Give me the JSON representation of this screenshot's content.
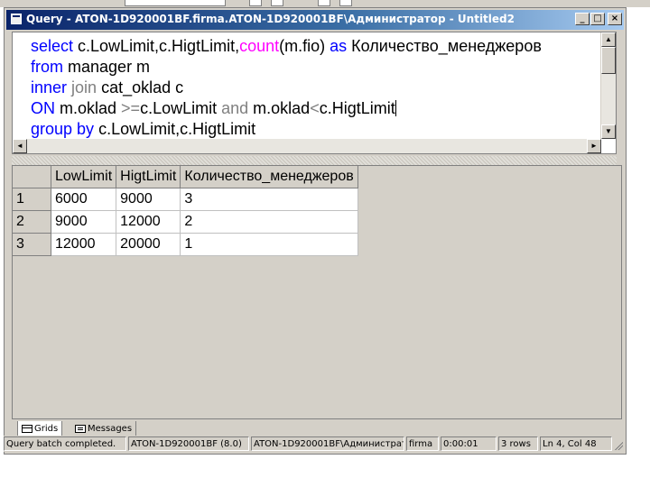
{
  "window": {
    "title": "Query - ATON-1D920001BF.firma.ATON-1D920001BF\\Администратор - Untitled2*"
  },
  "title_buttons": {
    "minimize": "_",
    "maximize": "□",
    "close": "×"
  },
  "editor": {
    "lines": [
      [
        {
          "t": "select ",
          "c": "kw"
        },
        {
          "t": "c.LowLimit,c.HigtLimit,",
          "c": "tx"
        },
        {
          "t": "count",
          "c": "fn"
        },
        {
          "t": "(m.fio) ",
          "c": "tx"
        },
        {
          "t": "as ",
          "c": "kw"
        },
        {
          "t": "Количество_менеджеров",
          "c": "tx"
        }
      ],
      [
        {
          "t": "from ",
          "c": "kw"
        },
        {
          "t": "manager m",
          "c": "tx"
        }
      ],
      [
        {
          "t": "inner ",
          "c": "kw"
        },
        {
          "t": "join ",
          "c": "op"
        },
        {
          "t": "cat_oklad c",
          "c": "tx"
        }
      ],
      [
        {
          "t": "ON ",
          "c": "kw"
        },
        {
          "t": "m.oklad ",
          "c": "tx"
        },
        {
          "t": ">=",
          "c": "op"
        },
        {
          "t": "c.LowLimit ",
          "c": "tx"
        },
        {
          "t": "and ",
          "c": "op"
        },
        {
          "t": "m.oklad",
          "c": "tx"
        },
        {
          "t": "<",
          "c": "op"
        },
        {
          "t": "c.HigtLimit",
          "c": "tx"
        }
      ],
      [
        {
          "t": "group by ",
          "c": "kw"
        },
        {
          "t": "c.LowLimit,c.HigtLimit",
          "c": "tx"
        }
      ]
    ]
  },
  "grid": {
    "columns": [
      "LowLimit",
      "HigtLimit",
      "Количество_менеджеров"
    ],
    "rows": [
      {
        "num": "1",
        "cells": [
          "6000",
          "9000",
          "3"
        ]
      },
      {
        "num": "2",
        "cells": [
          "9000",
          "12000",
          "2"
        ]
      },
      {
        "num": "3",
        "cells": [
          "12000",
          "20000",
          "1"
        ]
      }
    ]
  },
  "tabs": {
    "grids": "Grids",
    "messages": "Messages"
  },
  "status": {
    "message": "Query batch completed.",
    "server": "ATON-1D920001BF (8.0)",
    "user": "ATON-1D920001BF\\Администратор",
    "database": "firma",
    "elapsed": "0:00:01",
    "rows": "3 rows",
    "position": "Ln 4, Col 48"
  },
  "colors": {
    "keyword": "#0000ff",
    "function": "#ff00ff",
    "operator": "#808080",
    "titlebar": "#0a246a",
    "chrome": "#d4d0c8"
  }
}
